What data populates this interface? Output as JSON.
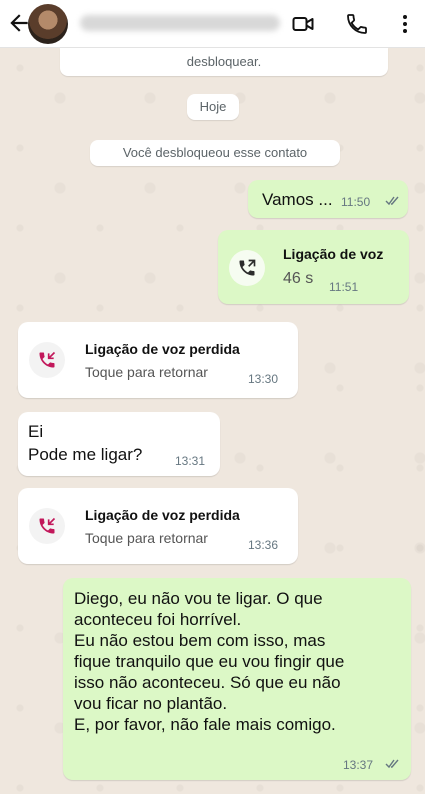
{
  "header": {
    "phone_hidden": true
  },
  "colors": {
    "outgoing": "#dcf8c6",
    "incoming": "#ffffff",
    "missed_call": "#c2185b",
    "background": "#efe7de"
  },
  "system": {
    "unblock_tail": "desbloquear.",
    "date_chip": "Hoje",
    "unblocked_notice": "Você desbloqueou esse contato"
  },
  "messages": {
    "m1": {
      "text": "Vamos ...",
      "time": "11:50"
    },
    "call1": {
      "title": "Ligação de voz",
      "duration": "46 s",
      "time": "11:51"
    },
    "missed1": {
      "title": "Ligação de voz perdida",
      "sub": "Toque para retornar",
      "time": "13:30"
    },
    "m2": {
      "line1": "Ei",
      "line2": "Pode me ligar?",
      "time": "13:31"
    },
    "missed2": {
      "title": "Ligação de voz perdida",
      "sub": "Toque para retornar",
      "time": "13:36"
    },
    "m3": {
      "lines": [
        "Diego, eu não vou te ligar. O que",
        "aconteceu foi horrível.",
        "Eu não estou bem com isso, mas",
        "fique tranquilo que eu vou fingir que",
        "isso não aconteceu. Só que eu não",
        "vou ficar no plantão.",
        "E, por favor, não fale mais comigo."
      ],
      "time": "13:37"
    }
  }
}
